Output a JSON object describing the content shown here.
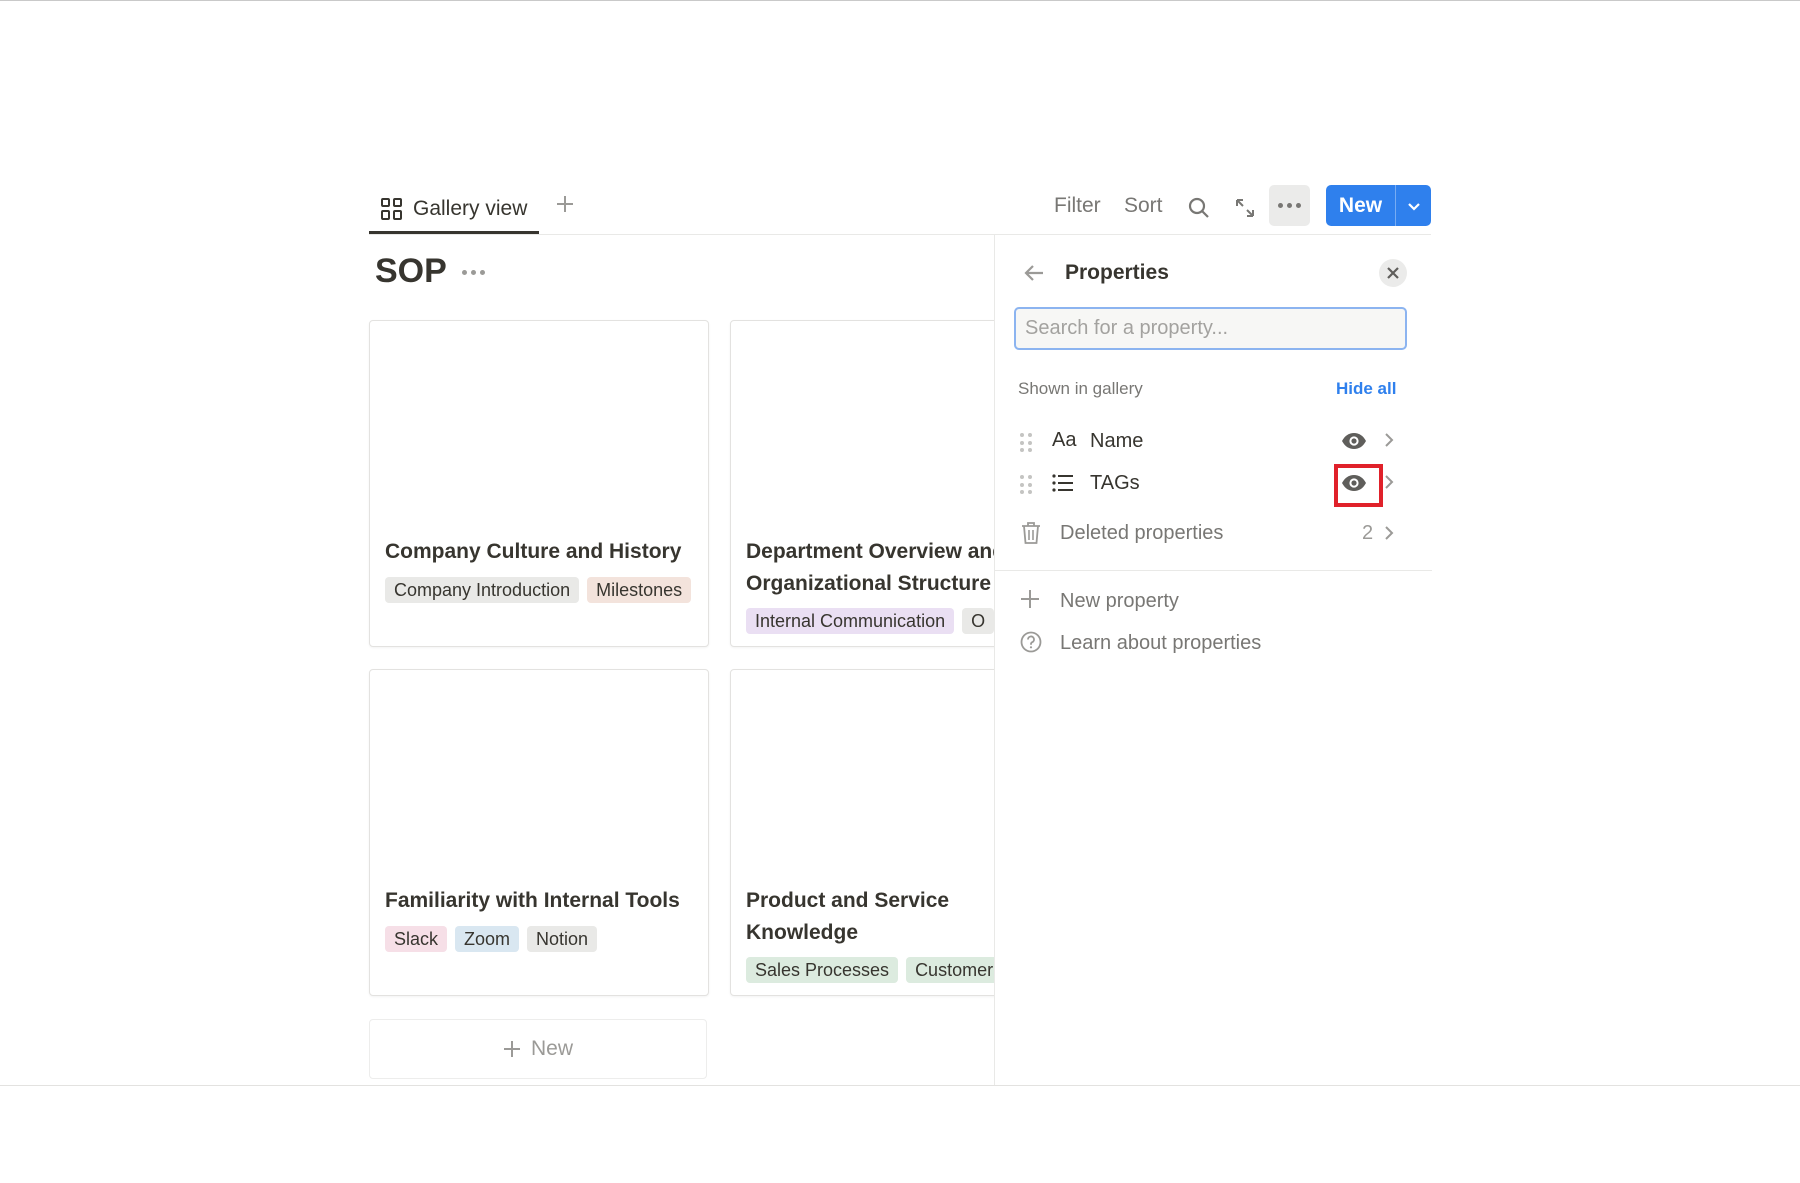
{
  "toolbar": {
    "view_tab_label": "Gallery view",
    "filter_label": "Filter",
    "sort_label": "Sort",
    "new_button_label": "New"
  },
  "database": {
    "title": "SOP"
  },
  "cards": [
    {
      "title": "Company Culture and History",
      "tags": [
        "Company Introduction",
        "Milestones"
      ]
    },
    {
      "title": "Department Overview and Organizational Structure",
      "tags": [
        "Internal Communication",
        "O"
      ]
    },
    {
      "title": "Familiarity with Internal Tools",
      "tags": [
        "Slack",
        "Zoom",
        "Notion"
      ]
    },
    {
      "title": "Product and Service Knowledge",
      "tags": [
        "Sales Processes",
        "Customer"
      ]
    }
  ],
  "tag_colors": {
    "Company Introduction": "#e9e9e7",
    "Milestones": "#f3e3dc",
    "Internal Communication": "#eadff3",
    "O": "#e9e9e7",
    "Slack": "#f6dfe7",
    "Zoom": "#d9e7f1",
    "Notion": "#e9e9e7",
    "Sales Processes": "#dcebdf",
    "Customer": "#dcebdf"
  },
  "gallery_new_label": "New",
  "properties_panel": {
    "title": "Properties",
    "search_placeholder": "Search for a property...",
    "section_label": "Shown in gallery",
    "hide_all_label": "Hide all",
    "properties": [
      {
        "type_icon": "Aa",
        "name": "Name",
        "visible": true
      },
      {
        "type_icon": "list-icon",
        "name": "TAGs",
        "visible": true
      }
    ],
    "deleted_label": "Deleted properties",
    "deleted_count": "2",
    "new_property_label": "New property",
    "learn_label": "Learn about properties"
  },
  "colors": {
    "accent": "#2f80ed",
    "highlight_box": "#e0212a"
  }
}
